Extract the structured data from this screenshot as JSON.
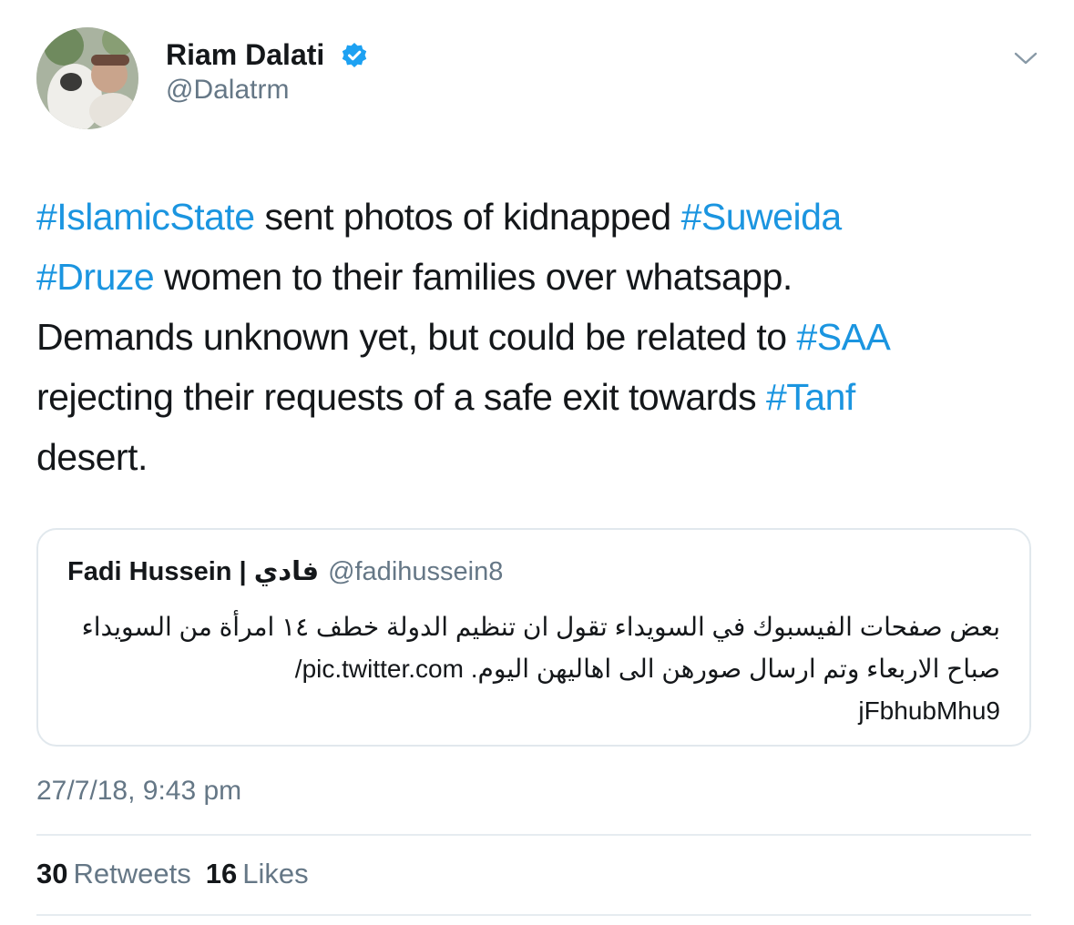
{
  "author": {
    "display_name": "Riam Dalati",
    "handle": "@Dalatrm",
    "verified": true
  },
  "tweet": {
    "lines": [
      [
        {
          "text": "#IslamicState",
          "hashtag": true
        },
        {
          "text": " sent photos of kidnapped ",
          "hashtag": false
        },
        {
          "text": "#Suweida",
          "hashtag": true
        }
      ],
      [
        {
          "text": "#Druze",
          "hashtag": true
        },
        {
          "text": " women to their families over whatsapp.",
          "hashtag": false
        }
      ],
      [
        {
          "text": "Demands unknown yet, but could be related to ",
          "hashtag": false
        },
        {
          "text": "#SAA",
          "hashtag": true
        }
      ],
      [
        {
          "text": "rejecting their requests of a safe exit towards ",
          "hashtag": false
        },
        {
          "text": "#Tanf",
          "hashtag": true
        }
      ],
      [
        {
          "text": "desert.",
          "hashtag": false
        }
      ]
    ]
  },
  "quoted_tweet": {
    "display_name": "Fadi Hussein | فادي",
    "handle": "@fadihussein8",
    "lines": [
      "بعض صفحات الفيسبوك في السويداء تقول ان تنظيم الدولة خطف ١٤ امرأة من السويداء",
      "صباح الاربعاء وتم ارسال صورهن الى اهاليهن اليوم. pic.twitter.com/",
      "jFbhubMhu9"
    ]
  },
  "timestamp": "27/7/18, 9:43 pm",
  "stats": {
    "retweets_count": "30",
    "retweets_label": "Retweets",
    "likes_count": "16",
    "likes_label": "Likes"
  },
  "colors": {
    "accent": "#1b95e0",
    "verified": "#1da1f2",
    "secondary_text": "#657786",
    "border": "#e1e8ed"
  },
  "icons": {
    "verified": "verified-badge-icon",
    "menu": "chevron-down-icon"
  }
}
